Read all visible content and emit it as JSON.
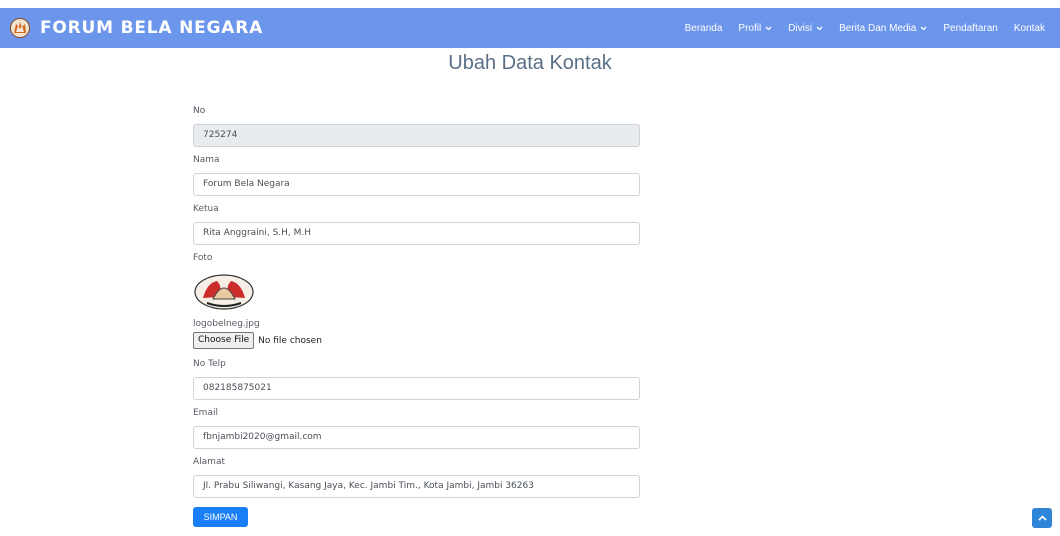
{
  "brand": {
    "name": "FORUM BELA NEGARA",
    "logo_icon": "bela-negara-logo-icon"
  },
  "nav": {
    "items": [
      {
        "label": "Beranda",
        "has_dropdown": false
      },
      {
        "label": "Profil",
        "has_dropdown": true
      },
      {
        "label": "Divisi",
        "has_dropdown": true
      },
      {
        "label": "Berita Dan Media",
        "has_dropdown": true
      },
      {
        "label": "Pendaftaran",
        "has_dropdown": false
      },
      {
        "label": "Kontak",
        "has_dropdown": false
      }
    ]
  },
  "page": {
    "title": "Ubah Data Kontak"
  },
  "form": {
    "no": {
      "label": "No",
      "value": "725274"
    },
    "nama": {
      "label": "Nama",
      "value": "Forum Bela Negara"
    },
    "ketua": {
      "label": "Ketua",
      "value": "Rita Anggraini, S.H, M.H"
    },
    "foto": {
      "label": "Foto",
      "filename": "logobelneg.jpg",
      "button_label": "Choose File",
      "status": "No file chosen"
    },
    "telp": {
      "label": "No Telp",
      "value": "082185875021"
    },
    "email": {
      "label": "Email",
      "value": "fbnjambi2020@gmail.com"
    },
    "alamat": {
      "label": "Alamat",
      "value": "Jl. Prabu Siliwangi, Kasang Jaya, Kec. Jambi Tim., Kota Jambi, Jambi 36263"
    },
    "submit_label": "SIMPAN"
  },
  "scroll_top": {
    "icon": "chevron-up-icon"
  },
  "colors": {
    "navbar": "#6c95ec",
    "primary_button": "#1a7ef6",
    "scroll_button": "#2f86d8",
    "readonly_field": "#e9ecef"
  }
}
